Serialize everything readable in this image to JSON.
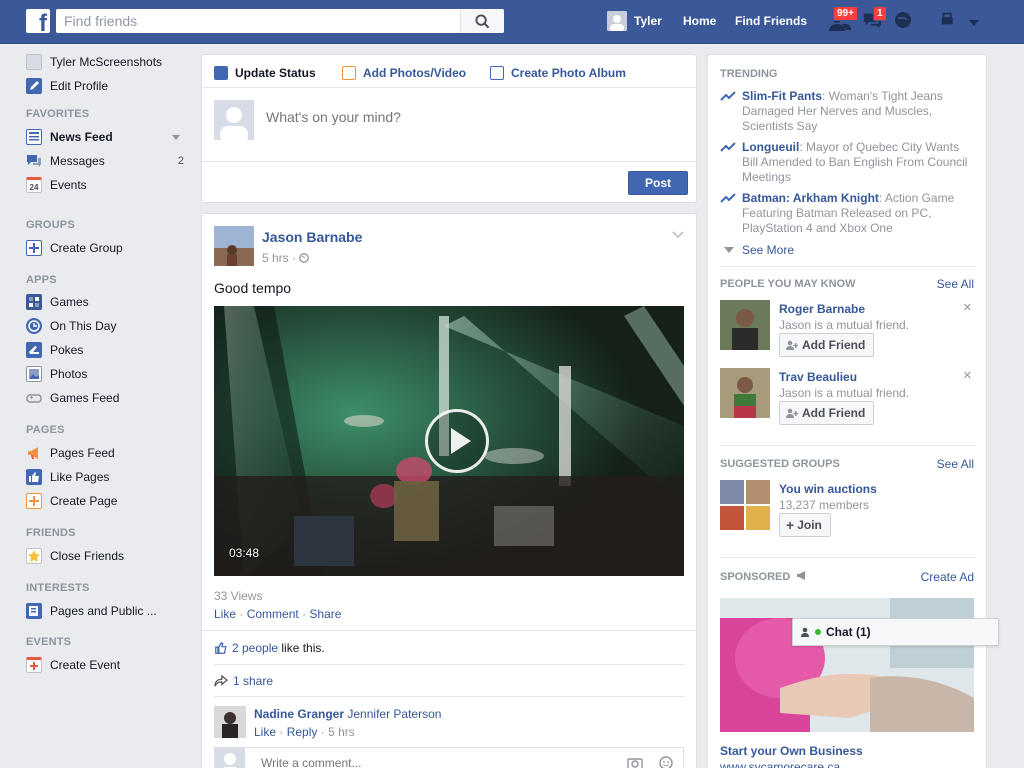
{
  "topbar": {
    "logo": "f",
    "search_placeholder": "Find friends",
    "user_name": "Tyler",
    "home": "Home",
    "find_friends": "Find Friends",
    "friend_requests_badge": "99+",
    "messages_badge": "1"
  },
  "left_nav": {
    "profile_name": "Tyler McScreenshots",
    "edit_profile": "Edit Profile",
    "favorites_head": "FAVORITES",
    "news_feed": "News Feed",
    "messages": "Messages",
    "messages_count": "2",
    "events": "Events",
    "events_icon_day": "24",
    "groups_head": "GROUPS",
    "create_group": "Create Group",
    "apps_head": "APPS",
    "games": "Games",
    "on_this_day": "On This Day",
    "pokes": "Pokes",
    "photos": "Photos",
    "games_feed": "Games Feed",
    "pages_head": "PAGES",
    "pages_feed": "Pages Feed",
    "like_pages": "Like Pages",
    "create_page": "Create Page",
    "friends_head": "FRIENDS",
    "close_friends": "Close Friends",
    "interests_head": "INTERESTS",
    "pages_and_public": "Pages and Public ...",
    "events_head": "EVENTS",
    "create_event": "Create Event"
  },
  "composer": {
    "update_status": "Update Status",
    "add_photos": "Add Photos/Video",
    "create_album": "Create Photo Album",
    "placeholder": "What's on your mind?",
    "post": "Post"
  },
  "story": {
    "author": "Jason Barnabe",
    "time": "5 hrs ·",
    "text": "Good tempo",
    "duration": "03:48",
    "views": "33 Views",
    "like": "Like",
    "comment": "Comment",
    "share": "Share",
    "likes_link": "2 people",
    "likes_suffix": " like this.",
    "shares": "1 share",
    "comment_author": "Nadine Granger",
    "comment_tagged": "Jennifer Paterson",
    "comment_like": "Like",
    "comment_reply": "Reply",
    "comment_time": "5 hrs",
    "write_placeholder": "Write a comment..."
  },
  "trending": {
    "head": "TRENDING",
    "items": [
      {
        "title": "Slim-Fit Pants",
        "text": ": Woman's Tight Jeans Damaged Her Nerves and Muscles, Scientists Say"
      },
      {
        "title": "Longueuil",
        "text": ": Mayor of Quebec City Wants Bill Amended to Ban English From Council Meetings"
      },
      {
        "title": "Batman: Arkham Knight",
        "text": ": Action Game Featuring Batman Released on PC, PlayStation 4 and Xbox One"
      }
    ],
    "see_more": "See More"
  },
  "pymk": {
    "head": "PEOPLE YOU MAY KNOW",
    "see_all": "See All",
    "people": [
      {
        "name": "Roger Barnabe",
        "mutual": "Jason is a mutual friend.",
        "button": "Add Friend"
      },
      {
        "name": "Trav Beaulieu",
        "mutual": "Jason is a mutual friend.",
        "button": "Add Friend"
      }
    ]
  },
  "groups": {
    "head": "SUGGESTED GROUPS",
    "see_all": "See All",
    "name": "You win auctions",
    "members": "13,237 members",
    "join": "Join"
  },
  "sponsored": {
    "head": "SPONSORED",
    "create_ad": "Create Ad",
    "ad_title": "Start your Own Business",
    "ad_url": "www.sycamorecare.ca"
  },
  "chat": {
    "label": "Chat (1)"
  },
  "colors": {
    "brand": "#3b5998",
    "link": "#365899",
    "badge": "#fa3e3e"
  }
}
